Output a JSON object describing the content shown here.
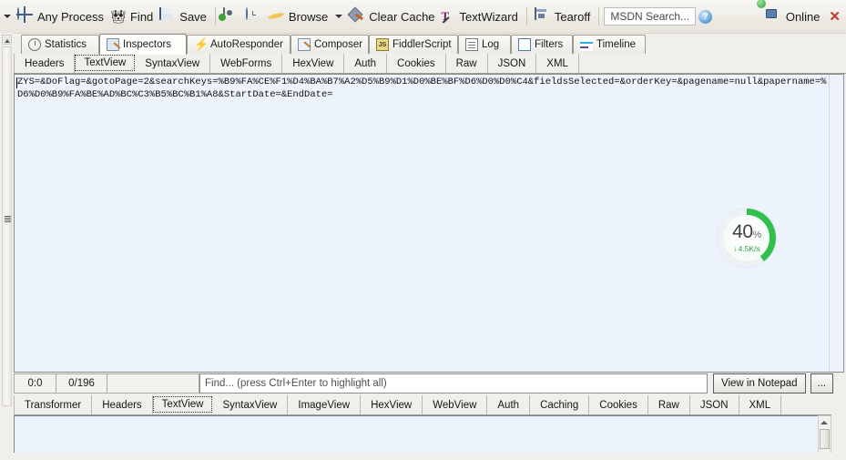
{
  "toolbar": {
    "items": [
      {
        "icon": "target-icon",
        "label": "Any Process",
        "name": "any-process-button"
      },
      {
        "icon": "binoculars-icon",
        "label": "Find",
        "name": "find-button"
      },
      {
        "icon": "save-icon",
        "label": "Save",
        "name": "save-button"
      },
      {
        "icon": "camera-icon",
        "label": "",
        "name": "screenshot-button"
      },
      {
        "icon": "timer-icon",
        "label": "",
        "name": "timer-button"
      },
      {
        "icon": "browser-icon",
        "label": "Browse",
        "name": "browse-button"
      },
      {
        "icon": "broom-icon",
        "label": "Clear Cache",
        "name": "clear-cache-button"
      },
      {
        "icon": "textwizard-icon",
        "label": "TextWizard",
        "name": "textwizard-button"
      },
      {
        "icon": "tearoff-icon",
        "label": "Tearoff",
        "name": "tearoff-button"
      }
    ],
    "msdn_search_placeholder": "MSDN Search...",
    "help_glyph": "?",
    "online_label": "Online",
    "close_glyph": "✕"
  },
  "main_tabs": [
    {
      "label": "Statistics",
      "icon": "statistics-icon",
      "active": false
    },
    {
      "label": "Inspectors",
      "icon": "inspectors-icon",
      "active": true
    },
    {
      "label": "AutoResponder",
      "icon": "autoresponder-icon",
      "active": false
    },
    {
      "label": "Composer",
      "icon": "composer-icon",
      "active": false
    },
    {
      "label": "FiddlerScript",
      "icon": "fiddlerscript-icon",
      "active": false
    },
    {
      "label": "Log",
      "icon": "log-icon",
      "active": false
    },
    {
      "label": "Filters",
      "icon": "filters-icon",
      "active": false
    },
    {
      "label": "Timeline",
      "icon": "timeline-icon",
      "active": false
    }
  ],
  "request_inspector": {
    "tabs": [
      {
        "label": "Headers",
        "selected": false
      },
      {
        "label": "TextView",
        "selected": true
      },
      {
        "label": "SyntaxView",
        "selected": false
      },
      {
        "label": "WebForms",
        "selected": false
      },
      {
        "label": "HexView",
        "selected": false
      },
      {
        "label": "Auth",
        "selected": false
      },
      {
        "label": "Cookies",
        "selected": false
      },
      {
        "label": "Raw",
        "selected": false
      },
      {
        "label": "JSON",
        "selected": false
      },
      {
        "label": "XML",
        "selected": false
      }
    ],
    "body_text": "ZYS=&DoFlag=&gotoPage=2&searchKeys=%B9%FA%CE%F1%D4%BA%B7%A2%D5%B9%D1%D0%BE%BF%D6%D0%D0%C4&fieldsSelected=&orderKey=&pagename=null&papername=%D6%D0%B9%FA%BE%AD%BC%C3%B5%BC%B1%A8&StartDate=&EndDate=",
    "status": {
      "position": "0:0",
      "selection": "0/196"
    },
    "find_placeholder": "Find... (press Ctrl+Enter to highlight all)",
    "find_value": "",
    "view_in_notepad_label": "View in Notepad",
    "more_label": "..."
  },
  "download_widget": {
    "percent": 40,
    "percent_label": "40",
    "percent_symbol": "%",
    "rate": "4.5K/s",
    "arrow_glyph": "↓",
    "ring_color": "#2fc14c",
    "ring_track_color": "#eef2f4",
    "text_color": "#3c4044"
  },
  "response_inspector": {
    "tabs": [
      {
        "label": "Transformer",
        "selected": false
      },
      {
        "label": "Headers",
        "selected": false
      },
      {
        "label": "TextView",
        "selected": true
      },
      {
        "label": "SyntaxView",
        "selected": false
      },
      {
        "label": "ImageView",
        "selected": false
      },
      {
        "label": "HexView",
        "selected": false
      },
      {
        "label": "WebView",
        "selected": false
      },
      {
        "label": "Auth",
        "selected": false
      },
      {
        "label": "Caching",
        "selected": false
      },
      {
        "label": "Cookies",
        "selected": false
      },
      {
        "label": "Raw",
        "selected": false
      },
      {
        "label": "JSON",
        "selected": false
      },
      {
        "label": "XML",
        "selected": false
      }
    ],
    "body_text": ""
  }
}
